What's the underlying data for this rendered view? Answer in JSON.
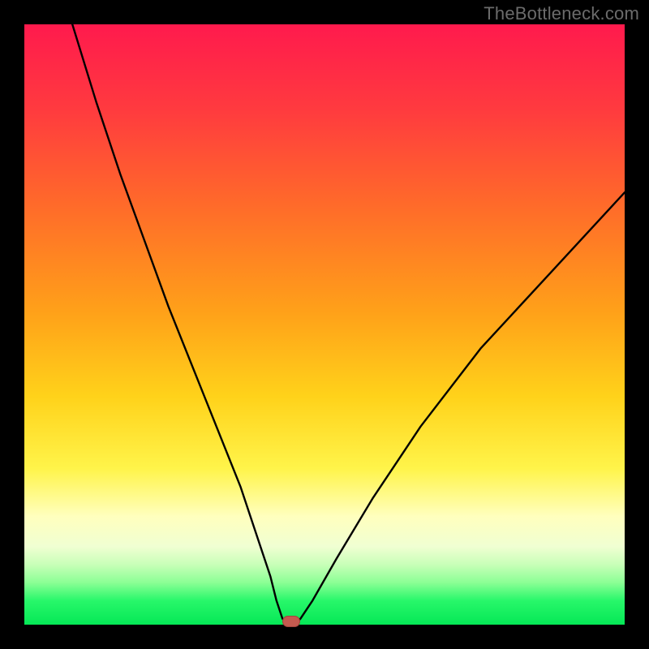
{
  "watermark": "TheBottleneck.com",
  "colors": {
    "frame": "#000000",
    "gradient_top": "#ff1a4d",
    "gradient_mid": "#ffd21a",
    "gradient_bottom": "#05e856",
    "curve": "#000000",
    "marker": "#c45a4f"
  },
  "chart_data": {
    "type": "line",
    "title": "",
    "xlabel": "",
    "ylabel": "",
    "xlim": [
      0,
      100
    ],
    "ylim": [
      0,
      100
    ],
    "series": [
      {
        "name": "bottleneck-curve",
        "x": [
          8,
          12,
          16,
          20,
          24,
          28,
          32,
          36,
          39,
          41,
          42,
          43,
          44,
          45,
          46,
          48,
          52,
          58,
          66,
          76,
          88,
          100
        ],
        "y": [
          100,
          87,
          75,
          64,
          53,
          43,
          33,
          23,
          14,
          8,
          4,
          1,
          0,
          0,
          1,
          4,
          11,
          21,
          33,
          46,
          59,
          72
        ]
      }
    ],
    "marker": {
      "x": 44.5,
      "y": 0.5,
      "shape": "pill"
    },
    "grid": false,
    "legend": false
  }
}
